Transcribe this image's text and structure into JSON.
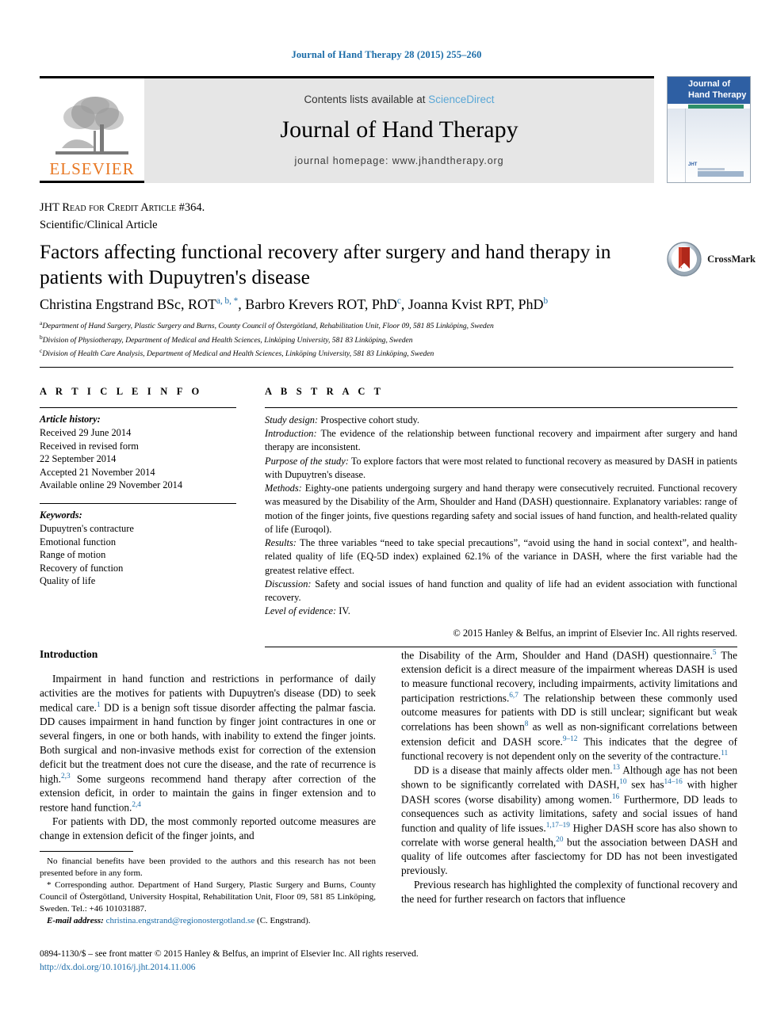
{
  "running_head": "Journal of Hand Therapy 28 (2015) 255–260",
  "masthead": {
    "contents_prefix": "Contents lists available at ",
    "sciencedirect": "ScienceDirect",
    "journal_name": "Journal of Hand Therapy",
    "homepage": "journal homepage: www.jhandtherapy.org",
    "publisher_wordmark": "ELSEVIER",
    "publisher_color": "#E87722"
  },
  "cover": {
    "title_line1": "Journal of",
    "title_line2": "Hand Therapy",
    "corner_mark": "JHT",
    "band_color": "#2e5fa3"
  },
  "article_type": {
    "line1": "JHT Read for Credit Article #364.",
    "line2": "Scientific/Clinical Article"
  },
  "title": "Factors affecting functional recovery after surgery and hand therapy in patients with Dupuytren's disease",
  "crossmark": {
    "label": "CrossMark"
  },
  "authors": [
    {
      "name": "Christina Engstrand BSc, ROT",
      "marks": "a, b, *"
    },
    {
      "name": "Barbro Krevers ROT, PhD",
      "marks": "c"
    },
    {
      "name": "Joanna Kvist RPT, PhD",
      "marks": "b"
    }
  ],
  "affiliations": [
    {
      "mark": "a",
      "text": "Department of Hand Surgery, Plastic Surgery and Burns, County Council of Östergötland, Rehabilitation Unit, Floor 09, 581 85 Linköping, Sweden"
    },
    {
      "mark": "b",
      "text": "Division of Physiotherapy, Department of Medical and Health Sciences, Linköping University, 581 83 Linköping, Sweden"
    },
    {
      "mark": "c",
      "text": "Division of Health Care Analysis, Department of Medical and Health Sciences, Linköping University, 581 83 Linköping, Sweden"
    }
  ],
  "article_info": {
    "heading": "A R T I C L E  I N F O",
    "history_label": "Article history:",
    "history": [
      "Received 29 June 2014",
      "Received in revised form",
      "22 September 2014",
      "Accepted 21 November 2014",
      "Available online 29 November 2014"
    ],
    "keywords_label": "Keywords:",
    "keywords": [
      "Dupuytren's contracture",
      "Emotional function",
      "Range of motion",
      "Recovery of function",
      "Quality of life"
    ]
  },
  "abstract": {
    "heading": "A B S T R A C T",
    "sections": [
      {
        "label": "Study design:",
        "text": " Prospective cohort study."
      },
      {
        "label": "Introduction:",
        "text": " The evidence of the relationship between functional recovery and impairment after surgery and hand therapy are inconsistent."
      },
      {
        "label": "Purpose of the study:",
        "text": " To explore factors that were most related to functional recovery as measured by DASH in patients with Dupuytren's disease."
      },
      {
        "label": "Methods:",
        "text": " Eighty-one patients undergoing surgery and hand therapy were consecutively recruited. Functional recovery was measured by the Disability of the Arm, Shoulder and Hand (DASH) questionnaire. Explanatory variables: range of motion of the finger joints, five questions regarding safety and social issues of hand function, and health-related quality of life (Euroqol)."
      },
      {
        "label": "Results:",
        "text": " The three variables “need to take special precautions”, “avoid using the hand in social context”, and health-related quality of life (EQ-5D index) explained 62.1% of the variance in DASH, where the first variable had the greatest relative effect."
      },
      {
        "label": "Discussion:",
        "text": " Safety and social issues of hand function and quality of life had an evident association with functional recovery."
      },
      {
        "label": "Level of evidence:",
        "text": " IV."
      }
    ],
    "copyright": "© 2015 Hanley & Belfus, an imprint of Elsevier Inc. All rights reserved."
  },
  "body": {
    "left_heading": "Introduction",
    "left_paragraphs": [
      "Impairment in hand function and restrictions in performance of daily activities are the motives for patients with Dupuytren's disease (DD) to seek medical care.<sup>1</sup> DD is a benign soft tissue disorder affecting the palmar fascia. DD causes impairment in hand function by finger joint contractures in one or several fingers, in one or both hands, with inability to extend the finger joints. Both surgical and non-invasive methods exist for correction of the extension deficit but the treatment does not cure the disease, and the rate of recurrence is high.<sup>2,3</sup> Some surgeons recommend hand therapy after correction of the extension deficit, in order to maintain the gains in finger extension and to restore hand function.<sup>2,4</sup>",
      "For patients with DD, the most commonly reported outcome measures are change in extension deficit of the finger joints, and"
    ],
    "right_paragraphs": [
      "the Disability of the Arm, Shoulder and Hand (DASH) questionnaire.<sup>5</sup> The extension deficit is a direct measure of the impairment whereas DASH is used to measure functional recovery, including impairments, activity limitations and participation restrictions.<sup>6,7</sup> The relationship between these commonly used outcome measures for patients with DD is still unclear; significant but weak correlations has been shown<sup>8</sup> as well as non-significant correlations between extension deficit and DASH score.<sup>9–12</sup> This indicates that the degree of functional recovery is not dependent only on the severity of the contracture.<sup>11</sup>",
      "DD is a disease that mainly affects older men.<sup>13</sup> Although age has not been shown to be significantly correlated with DASH,<sup>10</sup> sex has<sup>14–16</sup> with higher DASH scores (worse disability) among women.<sup>16</sup> Furthermore, DD leads to consequences such as activity limitations, safety and social issues of hand function and quality of life issues.<sup>1,17–19</sup> Higher DASH score has also shown to correlate with worse general health,<sup>20</sup> but the association between DASH and quality of life outcomes after fasciectomy for DD has not been investigated previously.",
      "Previous research has highlighted the complexity of functional recovery and the need for further research on factors that influence"
    ]
  },
  "footnotes": {
    "disclosure": "No financial benefits have been provided to the authors and this research has not been presented before in any form.",
    "corresponding": "* Corresponding author. Department of Hand Surgery, Plastic Surgery and Burns, County Council of Östergötland, University Hospital, Rehabilitation Unit, Floor 09, 581 85 Linköping, Sweden. Tel.: +46 101031887.",
    "email_label": "E-mail address:",
    "email": "christina.engstrand@regionostergotland.se",
    "email_suffix": "(C. Engstrand)."
  },
  "page_footer": {
    "line1": "0894-1130/$ – see front matter © 2015 Hanley & Belfus, an imprint of Elsevier Inc. All rights reserved.",
    "doi": "http://dx.doi.org/10.1016/j.jht.2014.11.006"
  },
  "colors": {
    "link_blue": "#1b6ca8",
    "sciencedirect_blue": "#5aa7d6",
    "elsevier_orange": "#E87722",
    "band_gray": "#e6e6e6"
  }
}
